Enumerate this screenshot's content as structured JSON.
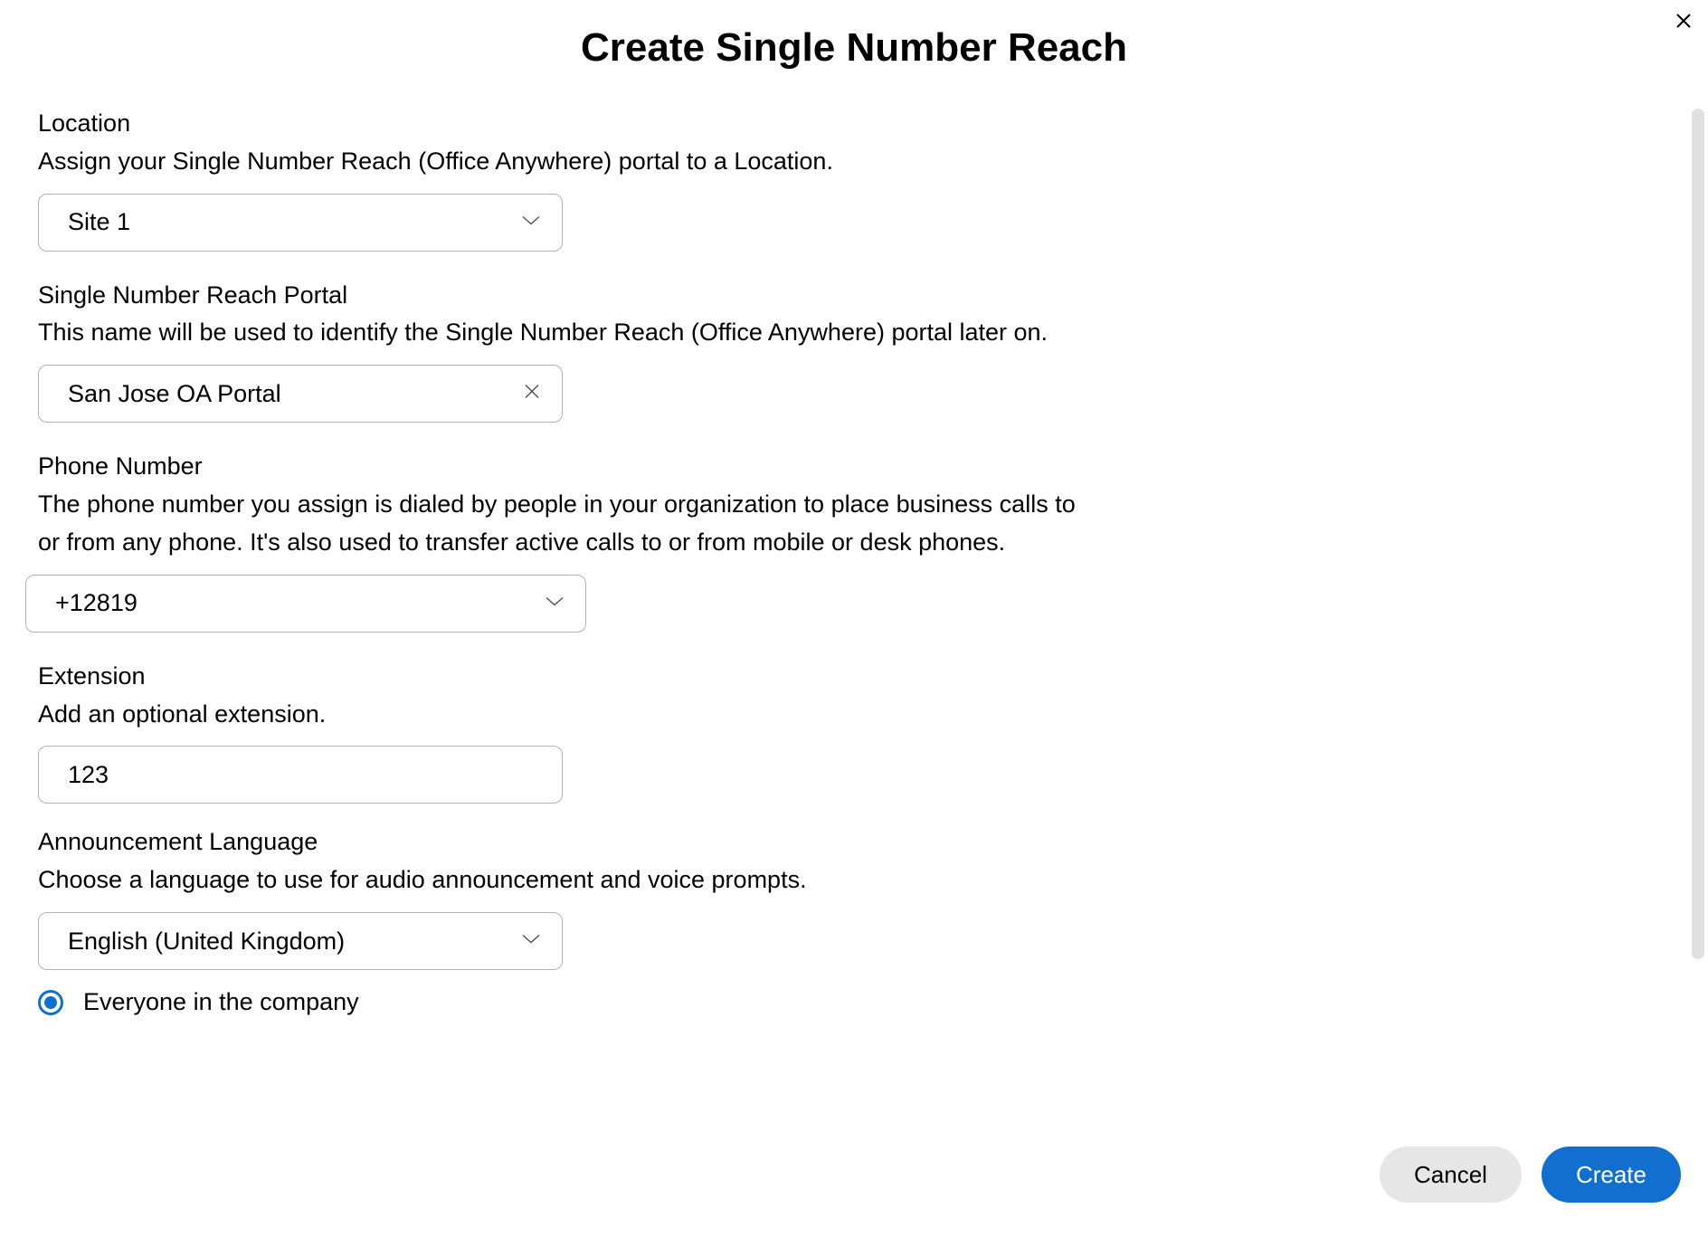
{
  "modal": {
    "title": "Create Single Number Reach"
  },
  "location": {
    "label": "Location",
    "description": "Assign your Single Number Reach (Office Anywhere) portal to a Location.",
    "value": "Site 1"
  },
  "portal": {
    "label": "Single Number Reach Portal",
    "description": "This name will be used to identify the Single Number Reach (Office Anywhere) portal later on.",
    "value": "San Jose OA Portal"
  },
  "phone": {
    "label": "Phone Number",
    "description": "The phone number you assign is dialed by people in your organization to place business calls to or from any phone. It's also used to transfer active calls to or from mobile or desk phones.",
    "value": "+12819"
  },
  "extension": {
    "label": "Extension",
    "description": "Add an optional extension.",
    "value": "123"
  },
  "language": {
    "label": "Announcement Language",
    "description": "Choose a language to use for audio announcement and voice prompts.",
    "value": "English (United Kingdom)"
  },
  "scope": {
    "option1": "Everyone in the company"
  },
  "footer": {
    "cancel": "Cancel",
    "create": "Create"
  }
}
